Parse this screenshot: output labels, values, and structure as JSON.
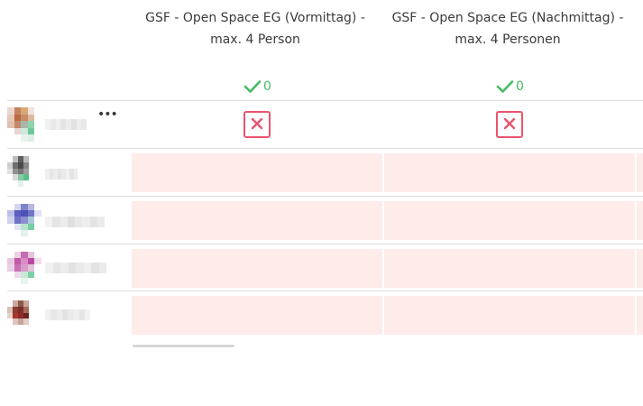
{
  "columns": [
    {
      "title": "GSF - Open Space EG (Vormittag) - max. 4 Person",
      "yes_count": "0"
    },
    {
      "title": "GSF - Open Space EG (Nachmittag) - max. 4 Personen",
      "yes_count": "0"
    }
  ],
  "current_user_row": {
    "more_label": "•••"
  },
  "colors": {
    "yes": "#46ba61",
    "no": "#e9546f",
    "empty_cell": "#fdecea",
    "divider": "#dedede"
  }
}
